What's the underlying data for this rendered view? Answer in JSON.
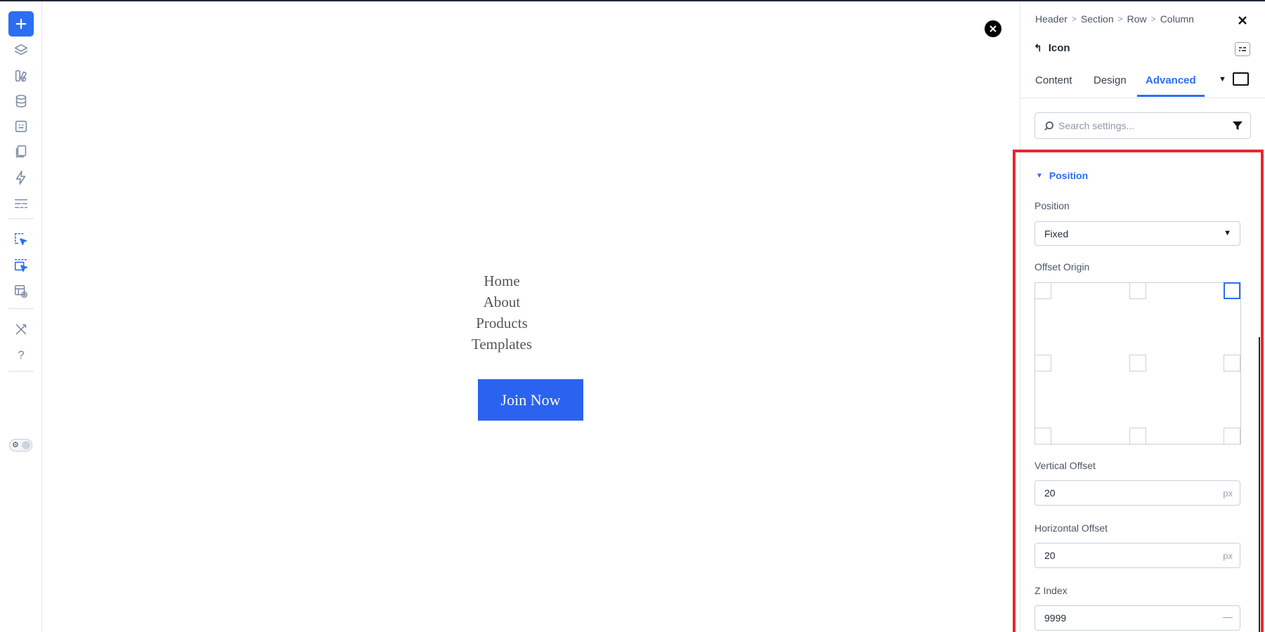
{
  "toolbar": {
    "add_label": "+",
    "help_label": "?",
    "icons": [
      "add-icon",
      "layers-icon",
      "widgets-icon",
      "database-icon",
      "dynamic-content-icon",
      "pages-icon",
      "interactions-icon",
      "layout-icon",
      "select-element-icon",
      "select-parent-icon",
      "preview-icon",
      "tools-icon",
      "help-icon"
    ],
    "accent": "#2b6ef2"
  },
  "canvas": {
    "menu_items": [
      "Home",
      "About",
      "Products",
      "Templates"
    ],
    "cta_label": "Join Now",
    "cta_color": "#2b62f0"
  },
  "panel": {
    "breadcrumb": [
      "Header",
      "Section",
      "Row",
      "Column"
    ],
    "back_glyph": "↰",
    "element_title": "Icon",
    "tabs": [
      "Content",
      "Design",
      "Advanced"
    ],
    "active_tab": "Advanced",
    "search": {
      "placeholder": "Search settings..."
    },
    "section": {
      "title": "Position",
      "position_label": "Position",
      "position_value": "Fixed",
      "offset_origin_label": "Offset Origin",
      "vertical_offset_label": "Vertical Offset",
      "vertical_offset_value": "20",
      "vertical_offset_unit": "px",
      "horizontal_offset_label": "Horizontal Offset",
      "horizontal_offset_value": "20",
      "horizontal_offset_unit": "px",
      "z_index_label": "Z Index",
      "z_index_value": "9999"
    },
    "highlight_color": "#e8272d"
  }
}
